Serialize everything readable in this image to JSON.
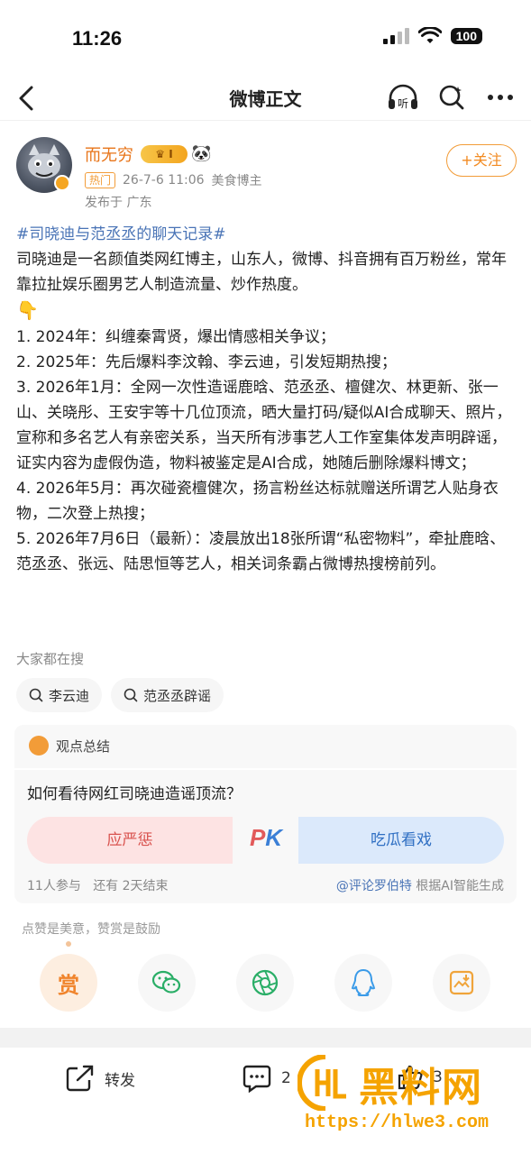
{
  "status": {
    "time": "11:26",
    "battery": "100"
  },
  "nav": {
    "title": "微博正文"
  },
  "author": {
    "name": "而无穷",
    "level_badge": "I",
    "emoji": "🐼",
    "hot_tag": "热门",
    "datetime": "26-7-6 11:06",
    "category": "美食博主",
    "location": "发布于 广东",
    "follow_label": "+关注"
  },
  "post": {
    "topic": "#司晓迪与范丞丞的聊天记录#",
    "intro": "司晓迪是一名颜值类网红博主，山东人，微博、抖音拥有百万粉丝，常年靠拉扯娱乐圈男艺人制造流量、炒作热度。",
    "pointer": "👇",
    "items": [
      "1. 2024年：纠缠秦霄贤，爆出情感相关争议；",
      "2. 2025年：先后爆料李汶翰、李云迪，引发短期热搜；",
      "3. 2026年1月：全网一次性造谣鹿晗、范丞丞、檀健次、林更新、张一山、关晓彤、王安宇等十几位顶流，晒大量打码/疑似AI合成聊天、照片，宣称和多名艺人有亲密关系，当天所有涉事艺人工作室集体发声明辟谣，证实内容为虚假伪造，物料被鉴定是AI合成，她随后删除爆料博文；",
      "4. 2026年5月：再次碰瓷檀健次，扬言粉丝达标就赠送所谓艺人贴身衣物，二次登上热搜；",
      "5. 2026年7月6日（最新）：凌晨放出18张所谓“私密物料”，牵扯鹿晗、范丞丞、张远、陆思恒等艺人，相关词条霸占微博热搜榜前列。"
    ]
  },
  "search": {
    "title": "大家都在搜",
    "chips": [
      "李云迪",
      "范丞丞辟谣"
    ]
  },
  "opinion": {
    "header": "观点总结",
    "question": "如何看待网红司晓迪造谣顶流？",
    "left_option": "应严惩",
    "right_option": "吃瓜看戏",
    "pk_p": "P",
    "pk_k": "K",
    "participants": "11人参与",
    "remaining": "还有 2天结束",
    "source_at": "@评论罗伯特",
    "source_note": "根据AI智能生成"
  },
  "reward": {
    "hint": "点赞是美意，赞赏是鼓励",
    "reward_label": "赏"
  },
  "bottom": {
    "repost_label": "转发",
    "comment_count": "2",
    "like_count": "3"
  },
  "watermark": {
    "title": "黑料网",
    "url": "https://hlwe3.com"
  },
  "colors": {
    "accent_orange": "#f29c38",
    "link_blue": "#4a74b6",
    "pk_red": "#e25a5a",
    "pk_blue": "#3b7fd6"
  }
}
